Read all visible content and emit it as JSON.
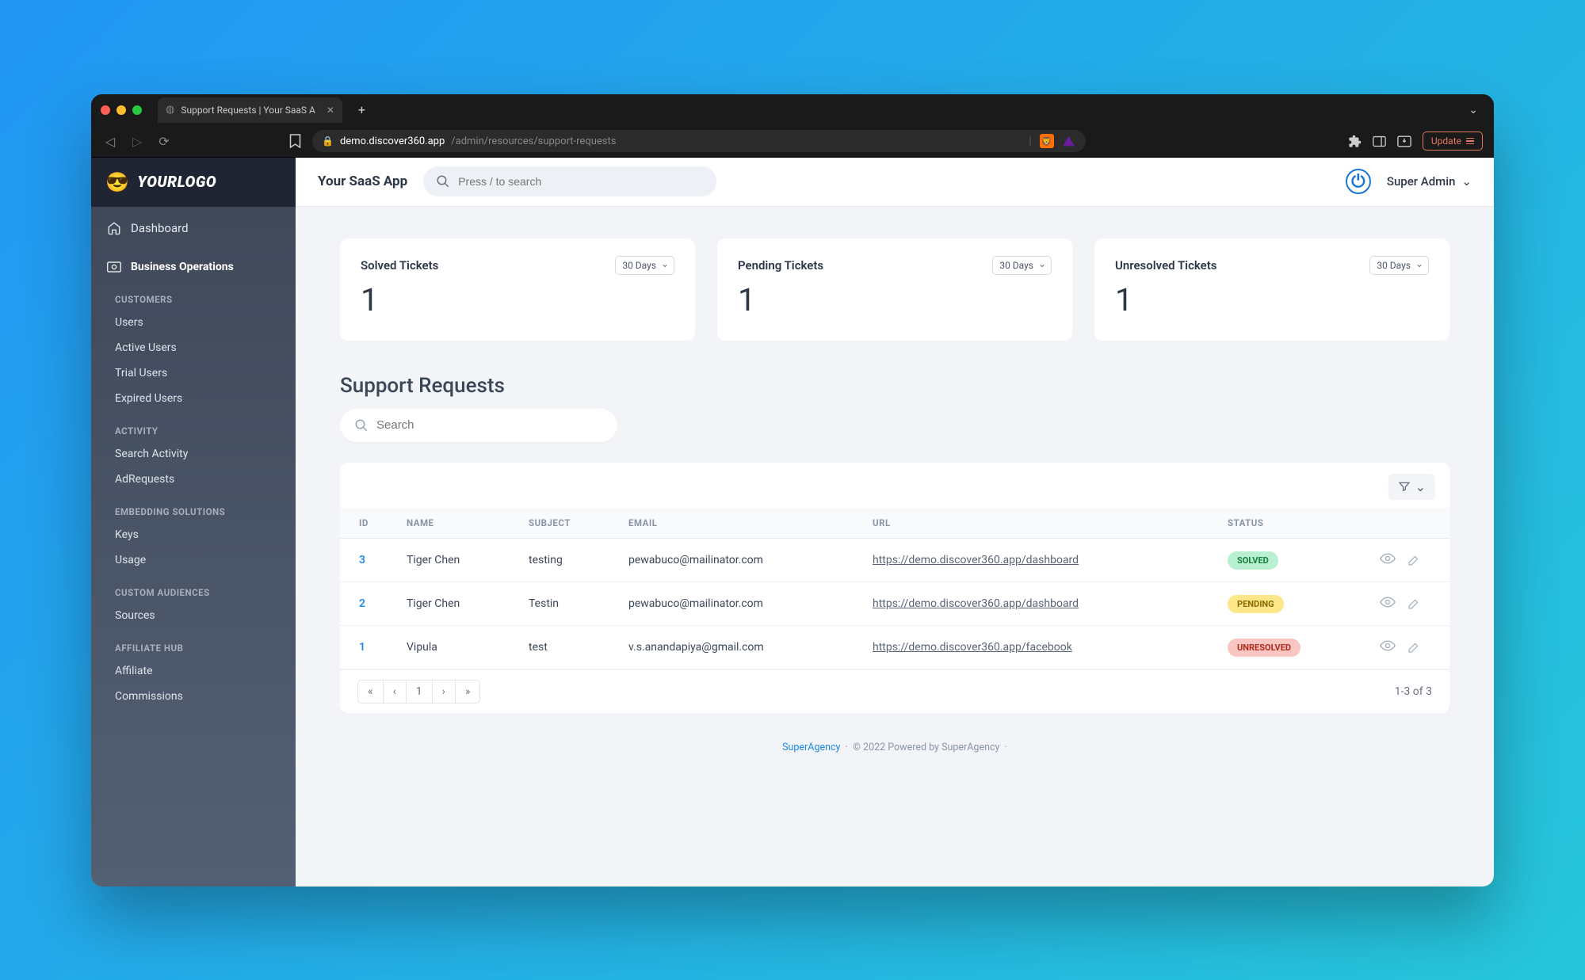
{
  "browser": {
    "tab_title": "Support Requests | Your SaaS A",
    "url_domain": "demo.discover360.app",
    "url_path": "/admin/resources/support-requests",
    "update_label": "Update"
  },
  "logo_text": "YOURLOGO",
  "sidebar": {
    "dashboard": "Dashboard",
    "business_ops": "Business Operations",
    "groups": [
      {
        "label": "CUSTOMERS",
        "items": [
          "Users",
          "Active Users",
          "Trial Users",
          "Expired Users"
        ]
      },
      {
        "label": "ACTIVITY",
        "items": [
          "Search Activity",
          "AdRequests"
        ]
      },
      {
        "label": "EMBEDDING SOLUTIONS",
        "items": [
          "Keys",
          "Usage"
        ]
      },
      {
        "label": "CUSTOM AUDIENCES",
        "items": [
          "Sources"
        ]
      },
      {
        "label": "AFFILIATE HUB",
        "items": [
          "Affiliate",
          "Commissions"
        ]
      }
    ]
  },
  "topbar": {
    "app_name": "Your SaaS App",
    "search_placeholder": "Press / to search",
    "user_label": "Super Admin"
  },
  "metrics": [
    {
      "title": "Solved Tickets",
      "period": "30 Days",
      "value": "1"
    },
    {
      "title": "Pending Tickets",
      "period": "30 Days",
      "value": "1"
    },
    {
      "title": "Unresolved Tickets",
      "period": "30 Days",
      "value": "1"
    }
  ],
  "section_title": "Support Requests",
  "local_search_placeholder": "Search",
  "table": {
    "headers": [
      "ID",
      "NAME",
      "SUBJECT",
      "EMAIL",
      "URL",
      "STATUS"
    ],
    "rows": [
      {
        "id": "3",
        "name": "Tiger Chen",
        "subject": "testing",
        "email": "pewabuco@mailinator.com",
        "url": "https://demo.discover360.app/dashboard",
        "status": "SOLVED",
        "status_class": "badge-solved"
      },
      {
        "id": "2",
        "name": "Tiger Chen",
        "subject": "Testin",
        "email": "pewabuco@mailinator.com",
        "url": "https://demo.discover360.app/dashboard",
        "status": "PENDING",
        "status_class": "badge-pending"
      },
      {
        "id": "1",
        "name": "Vipula",
        "subject": "test",
        "email": "v.s.anandapiya@gmail.com",
        "url": "https://demo.discover360.app/facebook",
        "status": "UNRESOLVED",
        "status_class": "badge-unresolved"
      }
    ],
    "pager": [
      "«",
      "‹",
      "1",
      "›",
      "»"
    ],
    "range": "1-3 of 3"
  },
  "footer": {
    "brand": "SuperAgency",
    "copy": "© 2022 Powered by SuperAgency"
  }
}
